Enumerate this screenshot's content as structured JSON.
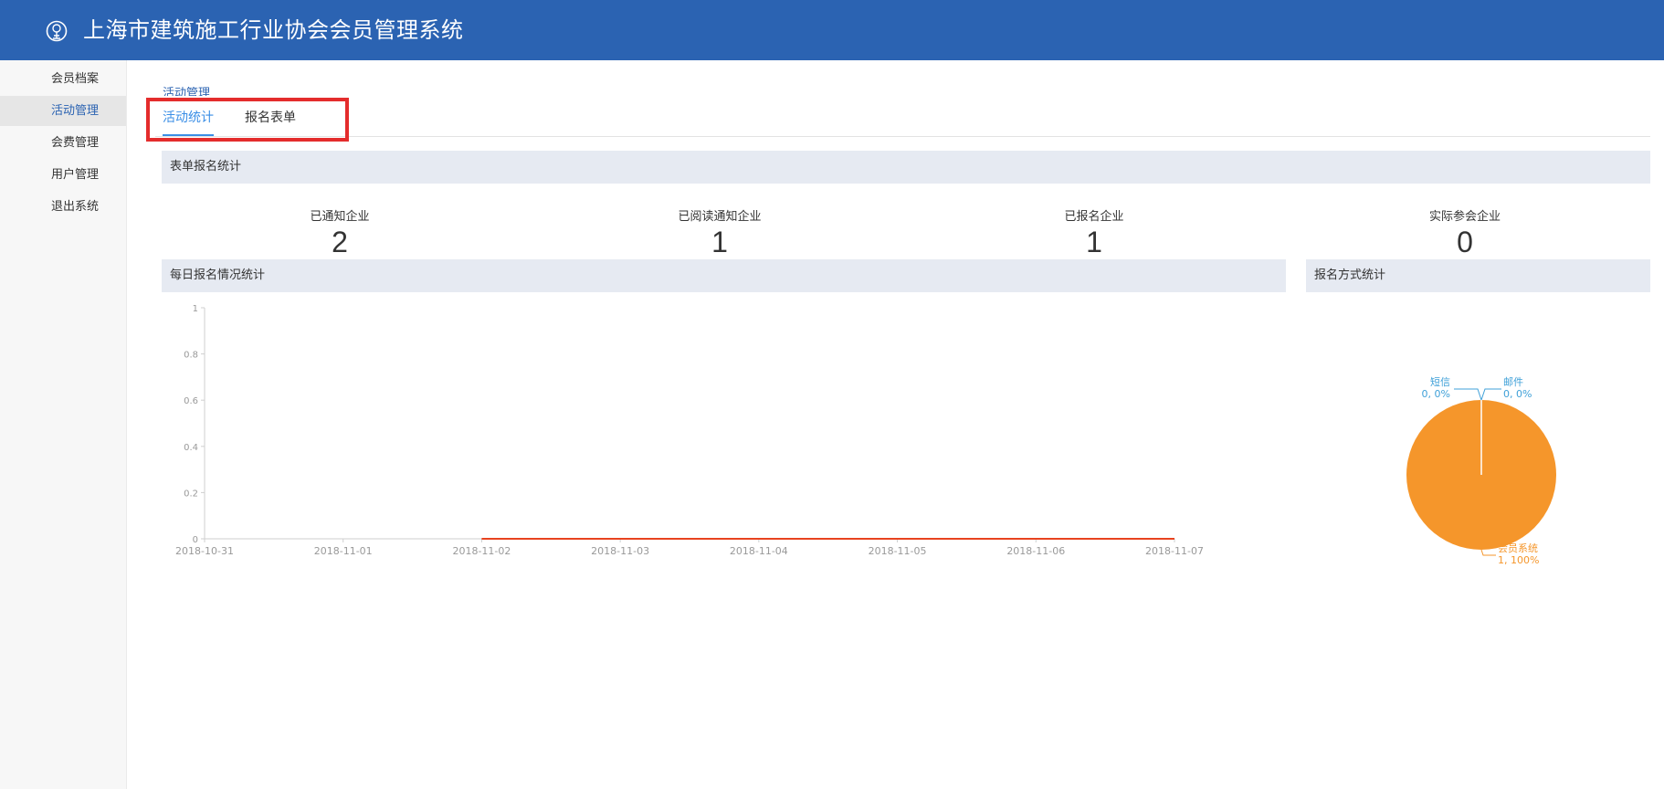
{
  "header": {
    "title": "上海市建筑施工行业协会会员管理系统"
  },
  "sidebar": {
    "items": [
      {
        "label": "会员档案",
        "active": false
      },
      {
        "label": "活动管理",
        "active": true
      },
      {
        "label": "会费管理",
        "active": false
      },
      {
        "label": "用户管理",
        "active": false
      },
      {
        "label": "退出系统",
        "active": false
      }
    ]
  },
  "breadcrumb": "活动管理",
  "tabs": [
    {
      "label": "活动统计",
      "active": true
    },
    {
      "label": "报名表单",
      "active": false
    }
  ],
  "sections": {
    "form_stats": "表单报名统计",
    "daily": "每日报名情况统计",
    "method": "报名方式统计"
  },
  "stats": [
    {
      "label": "已通知企业",
      "value": "2"
    },
    {
      "label": "已阅读通知企业",
      "value": "1"
    },
    {
      "label": "已报名企业",
      "value": "1"
    },
    {
      "label": "实际参会企业",
      "value": "0"
    }
  ],
  "colors": {
    "header": "#2b63b2",
    "line": "#e8431f",
    "pie_member": "#f5962b",
    "pie_label_sms": "#3fa0d8",
    "pie_label_email": "#3fa0d8",
    "highlight": "#e42c2c"
  },
  "chart_data": [
    {
      "type": "line",
      "x": [
        "2018-10-31",
        "2018-11-01",
        "2018-11-02",
        "2018-11-03",
        "2018-11-04",
        "2018-11-05",
        "2018-11-06",
        "2018-11-07"
      ],
      "series": [
        {
          "values": [
            null,
            null,
            0,
            0,
            0,
            0,
            0,
            0
          ]
        }
      ],
      "ylim": [
        0,
        1
      ],
      "yticks": [
        "0",
        "0.2",
        "0.4",
        "0.6",
        "0.8",
        "1"
      ]
    },
    {
      "type": "pie",
      "slices": [
        {
          "name": "短信",
          "value": 0,
          "label": "0, 0%"
        },
        {
          "name": "邮件",
          "value": 0,
          "label": "0, 0%"
        },
        {
          "name": "会员系统",
          "value": 1,
          "label": "1, 100%"
        }
      ]
    }
  ]
}
